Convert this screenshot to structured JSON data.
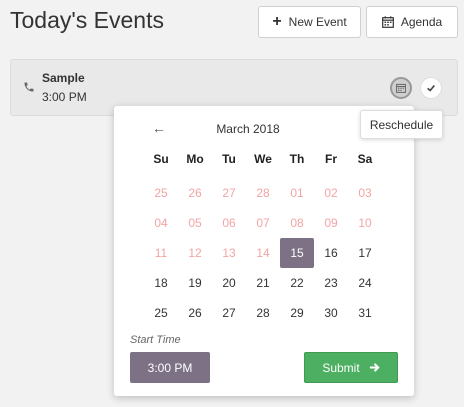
{
  "header": {
    "title": "Today's Events",
    "new_event_label": "New Event",
    "agenda_label": "Agenda"
  },
  "event": {
    "name": "Sample",
    "time": "3:00 PM"
  },
  "tooltip": {
    "text": "Reschedule"
  },
  "datepicker": {
    "prev_glyph": "←",
    "month_label": "March 2018",
    "weekdays": [
      "Su",
      "Mo",
      "Tu",
      "We",
      "Th",
      "Fr",
      "Sa"
    ],
    "selected_day": "15",
    "days": [
      {
        "label": "25",
        "disabled": true
      },
      {
        "label": "26",
        "disabled": true
      },
      {
        "label": "27",
        "disabled": true
      },
      {
        "label": "28",
        "disabled": true
      },
      {
        "label": "01",
        "disabled": true
      },
      {
        "label": "02",
        "disabled": true
      },
      {
        "label": "03",
        "disabled": true
      },
      {
        "label": "04",
        "disabled": true
      },
      {
        "label": "05",
        "disabled": true
      },
      {
        "label": "06",
        "disabled": true
      },
      {
        "label": "07",
        "disabled": true
      },
      {
        "label": "08",
        "disabled": true
      },
      {
        "label": "09",
        "disabled": true
      },
      {
        "label": "10",
        "disabled": true
      },
      {
        "label": "11",
        "disabled": true
      },
      {
        "label": "12",
        "disabled": true
      },
      {
        "label": "13",
        "disabled": true
      },
      {
        "label": "14",
        "disabled": true
      },
      {
        "label": "15",
        "disabled": false,
        "selected": true
      },
      {
        "label": "16",
        "disabled": false
      },
      {
        "label": "17",
        "disabled": false
      },
      {
        "label": "18",
        "disabled": false
      },
      {
        "label": "19",
        "disabled": false
      },
      {
        "label": "20",
        "disabled": false
      },
      {
        "label": "21",
        "disabled": false
      },
      {
        "label": "22",
        "disabled": false
      },
      {
        "label": "23",
        "disabled": false
      },
      {
        "label": "24",
        "disabled": false
      },
      {
        "label": "25",
        "disabled": false
      },
      {
        "label": "26",
        "disabled": false
      },
      {
        "label": "27",
        "disabled": false
      },
      {
        "label": "28",
        "disabled": false
      },
      {
        "label": "29",
        "disabled": false
      },
      {
        "label": "30",
        "disabled": false
      },
      {
        "label": "31",
        "disabled": false
      }
    ],
    "start_time_label": "Start Time",
    "start_time_value": "3:00 PM",
    "submit_label": "Submit"
  },
  "icons": {
    "new_event": "plus-icon",
    "agenda": "calendar-icon",
    "event_type": "phone-icon",
    "reschedule": "calendar-icon",
    "complete": "check-icon",
    "submit": "arrow-right-icon"
  },
  "colors": {
    "accent": "#7d7185",
    "submit": "#4caf61",
    "disabled_day": "#f2a4a4"
  }
}
